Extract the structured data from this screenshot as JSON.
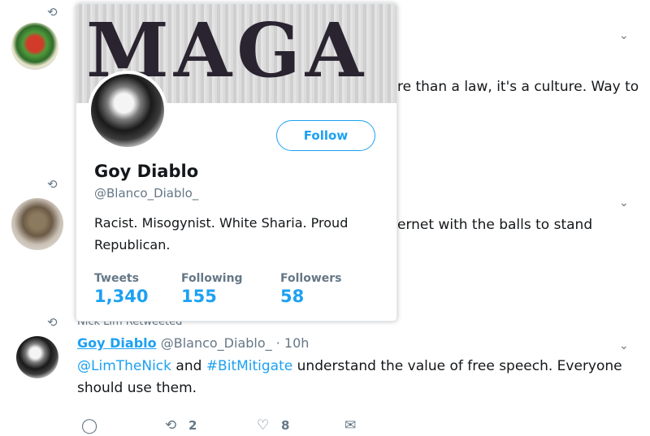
{
  "tweet1": {
    "text_visible": "re than a law, it's a culture. Way to"
  },
  "tweet2": {
    "text_visible": "ernet with the balls to stand"
  },
  "tweet3": {
    "retweet_context": "Nick Lim Retweeted",
    "author_name": "Goy Diablo",
    "author_handle": "@Blanco_Diablo_",
    "separator": "·",
    "time": "10h",
    "mention": "@LimTheNick",
    "text_and": "and",
    "hashtag": "#BitMitigate",
    "text_rest": "understand the value of free speech. Everyone",
    "text_line2": "should use them.",
    "actions": {
      "reply_icon": "reply-icon",
      "retweet_count": "2",
      "like_count": "8",
      "dm_icon": "message-icon"
    }
  },
  "hovercard": {
    "banner_text": "MAGA",
    "follow_label": "Follow",
    "name": "Goy Diablo",
    "handle": "@Blanco_Diablo_",
    "bio": "Racist. Misogynist. White Sharia. Proud Republican.",
    "stats": [
      {
        "label": "Tweets",
        "value": "1,340"
      },
      {
        "label": "Following",
        "value": "155"
      },
      {
        "label": "Followers",
        "value": "58"
      }
    ]
  },
  "colors": {
    "accent": "#1da1f2",
    "muted": "#657786",
    "text": "#14171a"
  }
}
